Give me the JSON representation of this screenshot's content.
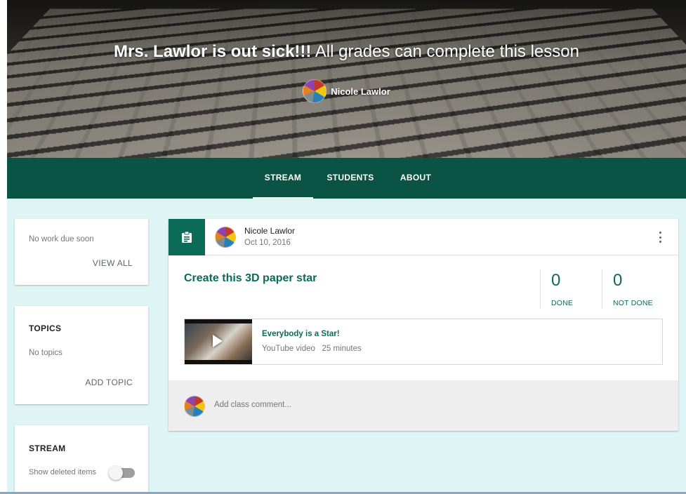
{
  "banner": {
    "title_bold": "Mrs. Lawlor is out sick!!!",
    "title_rest": "All grades can complete this lesson",
    "teacher": "Nicole Lawlor"
  },
  "nav": {
    "tabs": [
      {
        "label": "STREAM",
        "active": true
      },
      {
        "label": "STUDENTS",
        "active": false
      },
      {
        "label": "ABOUT",
        "active": false
      }
    ]
  },
  "sidebar": {
    "upcoming": {
      "text": "No work due soon",
      "link": "VIEW ALL"
    },
    "topics": {
      "heading": "TOPICS",
      "empty": "No topics",
      "link": "ADD TOPIC"
    },
    "stream": {
      "heading": "STREAM",
      "toggle_label": "Show deleted items",
      "toggle_on": false
    }
  },
  "post": {
    "author": "Nicole Lawlor",
    "date": "Oct 10, 2016",
    "title": "Create this 3D paper star",
    "done": {
      "count": "0",
      "label": "DONE"
    },
    "not_done": {
      "count": "0",
      "label": "NOT DONE"
    },
    "attachment": {
      "title": "Everybody is a Star!",
      "type": "YouTube video",
      "duration": "25 minutes"
    },
    "comment_placeholder": "Add class comment..."
  },
  "colors": {
    "nav_bg": "#0b5345",
    "accent": "#0b6b57",
    "page_bg": "#dff4f5"
  },
  "icons": [
    "assignment-icon",
    "more-vert-icon",
    "play-icon"
  ]
}
